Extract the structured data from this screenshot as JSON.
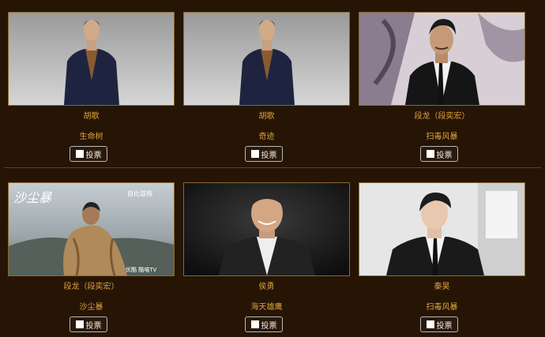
{
  "candidates": [
    {
      "name": "胡歌",
      "work": "生命树",
      "vote_label": "投票",
      "photo": "man-navy-suit-gray-background"
    },
    {
      "name": "胡歌",
      "work": "奇迹",
      "vote_label": "投票",
      "photo": "man-navy-suit-gray-background"
    },
    {
      "name": "段龙（段奕宏）",
      "work": "扫毒风暴",
      "vote_label": "投票",
      "photo": "man-black-suit-event-backdrop"
    },
    {
      "name": "段龙（段奕宏）",
      "work": "沙尘暴",
      "vote_label": "投票",
      "photo": "drama-poster-fur-coat"
    },
    {
      "name": "侯勇",
      "work": "海天雄鹰",
      "vote_label": "投票",
      "photo": "man-dark-suit-dark-background"
    },
    {
      "name": "秦昊",
      "work": "扫毒风暴",
      "vote_label": "投票",
      "photo": "man-black-suit-white-room"
    }
  ],
  "poster_text": {
    "title_art": "沙尘暴",
    "platform": "自比滋殇",
    "logos": "优酷  酷喵TV"
  },
  "colors": {
    "background": "#261505",
    "text_gold": "#e0a33c",
    "divider": "#5b4420"
  }
}
